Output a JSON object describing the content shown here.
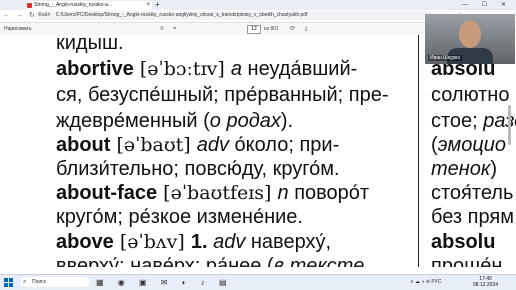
{
  "browser": {
    "tab_title": "Strong_-_Anglo-russkiy_russko-a...",
    "tab_close": "×",
    "new_tab": "+",
    "window_controls": "— ☐ ✕",
    "nav_icons": "← → ↻",
    "file_label": "Файл",
    "url": "C:/Users/PC/Desktop/Strong_-_Anglo-russkiy_russko-angliyskiy_slovar_s_transkriptsiey_v_obeikh_chastyakh.pdf",
    "right_icons": "☆ ⋮"
  },
  "pdf_toolbar": {
    "draw_label": "Нарисовать",
    "page_value": "12",
    "page_total": "из 801",
    "misc_icons": "≡ ⌖",
    "misc_icons2": "⟳ ⤓"
  },
  "document": {
    "lines": [
      {
        "hw": "",
        "text": "кидыш."
      },
      {
        "hw": "abortive",
        "ipa": " [əˈbɔːtɪv] ",
        "pos": "a",
        "text": " неуда́вший-"
      },
      {
        "hw": "",
        "text": "ся, безуспе́шный; пре́рванный; пре-"
      },
      {
        "hw": "",
        "text": "ждевре́менный (",
        "it": "о родах",
        "tail": ")."
      },
      {
        "hw": "about",
        "ipa": " [əˈbaʊt] ",
        "pos": "adv",
        "text": " о́коло; при-"
      },
      {
        "hw": "",
        "text": "близи́тельно; повсю́ду, круго́м."
      },
      {
        "hw": "about-face",
        "ipa": " [əˈbaʊtfeɪs] ",
        "pos": "n",
        "text": " поворо́т"
      },
      {
        "hw": "",
        "text": "круго́м; ре́зкое измене́ние."
      },
      {
        "hw": "above",
        "ipa": " [əˈbʌv] ",
        "pos": "",
        "text": "1. ",
        "pos2": "adv",
        "text2": " наверху́,"
      },
      {
        "hw": "",
        "text": "вверху́; наве́рх; ра́нее (",
        "it": "в тексте"
      }
    ],
    "col2_lines": [
      {
        "hw": "absolu"
      },
      {
        "text": "солютно"
      },
      {
        "text": "стое; ",
        "it": "разд"
      },
      {
        "text": "(",
        "it": "эмоцио"
      },
      {
        "it": "тенок",
        "tail": ")"
      },
      {
        "text": "стоя́тель"
      },
      {
        "text": "без прям"
      },
      {
        "hw": "absolu"
      },
      {
        "text": "проще́н"
      }
    ]
  },
  "webcam": {
    "name": "Иван Шкурко"
  },
  "taskbar": {
    "search_placeholder": "Поиск",
    "search_icon": "⌕",
    "apps": "▦ ◉ ▣ ✉ ◐ ♪ ▤",
    "tray": "∧ ☁ ◖ ⊜ РУС",
    "time": "17:40",
    "date": "08.12.2024"
  }
}
